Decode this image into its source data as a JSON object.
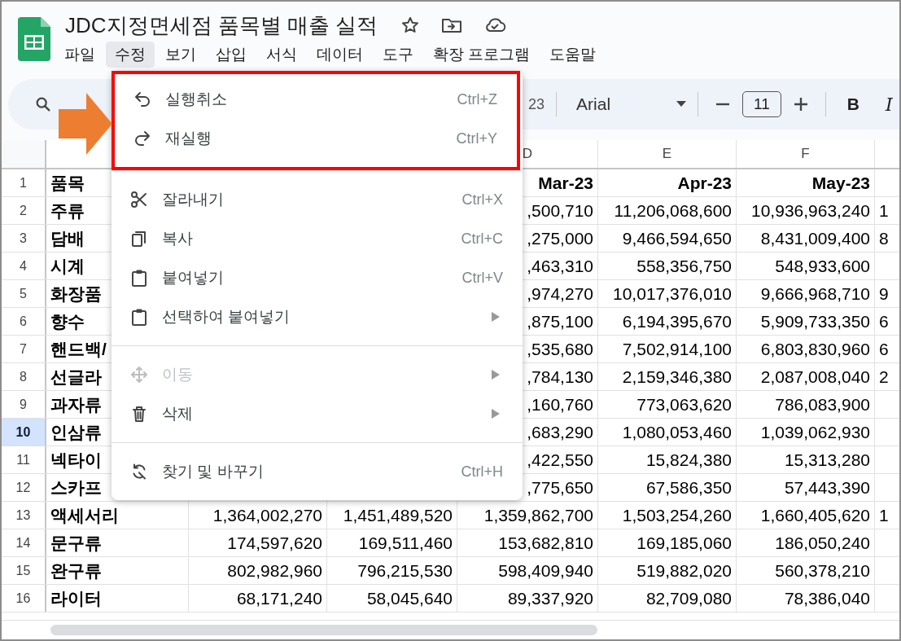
{
  "app": {
    "title": "JDC지정면세점 품목별 매출 실적"
  },
  "menu_bar": [
    {
      "label": "파일",
      "selected": false
    },
    {
      "label": "수정",
      "selected": true
    },
    {
      "label": "보기",
      "selected": false
    },
    {
      "label": "삽입",
      "selected": false
    },
    {
      "label": "서식",
      "selected": false
    },
    {
      "label": "데이터",
      "selected": false
    },
    {
      "label": "도구",
      "selected": false
    },
    {
      "label": "확장 프로그램",
      "selected": false
    },
    {
      "label": "도움말",
      "selected": false
    }
  ],
  "toolbar": {
    "number_format": "23",
    "font": "Arial",
    "font_size": "11",
    "bold": "B",
    "italic": "I"
  },
  "edit_menu": {
    "groups": [
      {
        "highlighted": true,
        "items": [
          {
            "kind": "undo",
            "label": "실행취소",
            "shortcut": "Ctrl+Z",
            "disabled": false,
            "submenu": false
          },
          {
            "kind": "redo",
            "label": "재실행",
            "shortcut": "Ctrl+Y",
            "disabled": false,
            "submenu": false
          }
        ]
      },
      {
        "highlighted": false,
        "items": [
          {
            "kind": "cut",
            "label": "잘라내기",
            "shortcut": "Ctrl+X",
            "disabled": false,
            "submenu": false
          },
          {
            "kind": "copy",
            "label": "복사",
            "shortcut": "Ctrl+C",
            "disabled": false,
            "submenu": false
          },
          {
            "kind": "paste",
            "label": "붙여넣기",
            "shortcut": "Ctrl+V",
            "disabled": false,
            "submenu": false
          },
          {
            "kind": "paste",
            "label": "선택하여 붙여넣기",
            "disabled": false,
            "submenu": true
          }
        ]
      },
      {
        "highlighted": false,
        "items": [
          {
            "kind": "move",
            "label": "이동",
            "disabled": true,
            "submenu": true
          },
          {
            "kind": "delete",
            "label": "삭제",
            "disabled": false,
            "submenu": true
          }
        ]
      },
      {
        "highlighted": false,
        "items": [
          {
            "kind": "find",
            "label": "찾기 및 바꾸기",
            "shortcut": "Ctrl+H",
            "disabled": false,
            "submenu": false
          }
        ]
      }
    ]
  },
  "sheet": {
    "column_headers": {
      "D": "D",
      "E": "E",
      "F": "F"
    },
    "rows": [
      {
        "number": "1",
        "selected": false,
        "kind": "header",
        "cells": {
          "A": "품목",
          "D": "Mar-23",
          "E": "Apr-23",
          "F": "May-23"
        }
      },
      {
        "number": "2",
        "selected": false,
        "kind": "data",
        "cells": {
          "A": "주류",
          "D": ",500,710",
          "E": "11,206,068,600",
          "F": "10,936,963,240",
          "G": "1"
        }
      },
      {
        "number": "3",
        "selected": false,
        "kind": "data",
        "cells": {
          "A": "담배",
          "D": ",275,000",
          "E": "9,466,594,650",
          "F": "8,431,009,400",
          "G": "8"
        }
      },
      {
        "number": "4",
        "selected": false,
        "kind": "data",
        "cells": {
          "A": "시계",
          "D": ",463,310",
          "E": "558,356,750",
          "F": "548,933,600"
        }
      },
      {
        "number": "5",
        "selected": false,
        "kind": "data",
        "cells": {
          "A": "화장품",
          "D": ",974,270",
          "E": "10,017,376,010",
          "F": "9,666,968,710",
          "G": "9"
        }
      },
      {
        "number": "6",
        "selected": false,
        "kind": "data",
        "cells": {
          "A": "향수",
          "D": ",875,100",
          "E": "6,194,395,670",
          "F": "5,909,733,350",
          "G": "6"
        }
      },
      {
        "number": "7",
        "selected": false,
        "kind": "data",
        "cells": {
          "A": "핸드백/",
          "D": ",535,680",
          "E": "7,502,914,100",
          "F": "6,803,830,960",
          "G": "6"
        }
      },
      {
        "number": "8",
        "selected": false,
        "kind": "data",
        "cells": {
          "A": "선글라",
          "D": ",784,130",
          "E": "2,159,346,380",
          "F": "2,087,008,040",
          "G": "2"
        }
      },
      {
        "number": "9",
        "selected": false,
        "kind": "data",
        "cells": {
          "A": "과자류",
          "D": ",160,760",
          "E": "773,063,620",
          "F": "786,083,900"
        }
      },
      {
        "number": "10",
        "selected": true,
        "kind": "data",
        "cells": {
          "A": "인삼류",
          "D": ",683,290",
          "E": "1,080,053,460",
          "F": "1,039,062,930"
        }
      },
      {
        "number": "11",
        "selected": false,
        "kind": "data",
        "cells": {
          "A": "넥타이",
          "D": ",422,550",
          "E": "15,824,380",
          "F": "15,313,280"
        }
      },
      {
        "number": "12",
        "selected": false,
        "kind": "data",
        "cells": {
          "A": "스카프",
          "D": ",775,650",
          "E": "67,586,350",
          "F": "57,443,390"
        }
      },
      {
        "number": "13",
        "selected": false,
        "kind": "data",
        "cells": {
          "A": "액세서리",
          "B": "1,364,002,270",
          "C": "1,451,489,520",
          "D": "1,359,862,700",
          "E": "1,503,254,260",
          "F": "1,660,405,620",
          "G": "1"
        }
      },
      {
        "number": "14",
        "selected": false,
        "kind": "data",
        "cells": {
          "A": "문구류",
          "B": "174,597,620",
          "C": "169,511,460",
          "D": "153,682,810",
          "E": "169,185,060",
          "F": "186,050,240"
        }
      },
      {
        "number": "15",
        "selected": false,
        "kind": "data",
        "cells": {
          "A": "완구류",
          "B": "802,982,960",
          "C": "796,215,530",
          "D": "598,409,940",
          "E": "519,882,020",
          "F": "560,378,210"
        }
      },
      {
        "number": "16",
        "selected": false,
        "kind": "data",
        "cells": {
          "A": "라이터",
          "B": "68,171,240",
          "C": "58,045,640",
          "D": "89,337,920",
          "E": "82,709,080",
          "F": "78,386,040"
        }
      }
    ]
  }
}
